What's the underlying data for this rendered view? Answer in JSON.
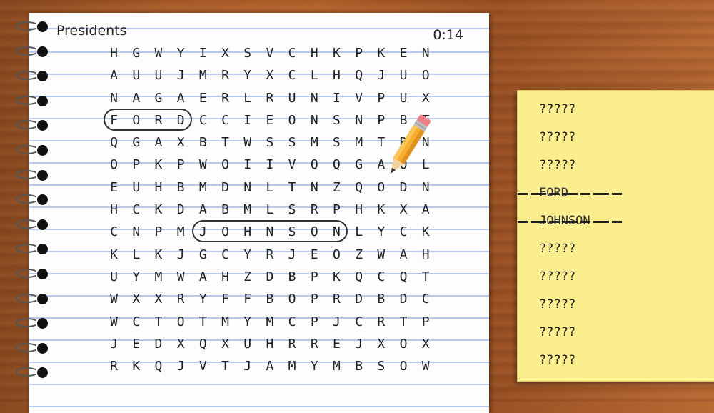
{
  "puzzle": {
    "title": "Presidents",
    "timer": "0:14",
    "grid": [
      [
        "H",
        "G",
        "W",
        "Y",
        "I",
        "X",
        "S",
        "V",
        "C",
        "H",
        "K",
        "P",
        "K",
        "E",
        "N"
      ],
      [
        "A",
        "U",
        "U",
        "J",
        "M",
        "R",
        "Y",
        "X",
        "C",
        "L",
        "H",
        "Q",
        "J",
        "U",
        "O"
      ],
      [
        "N",
        "A",
        "G",
        "A",
        "E",
        "R",
        "L",
        "R",
        "U",
        "N",
        "I",
        "V",
        "P",
        "U",
        "X"
      ],
      [
        "F",
        "O",
        "R",
        "D",
        "C",
        "C",
        "I",
        "E",
        "O",
        "N",
        "S",
        "N",
        "P",
        "B",
        "T"
      ],
      [
        "Q",
        "G",
        "A",
        "X",
        "B",
        "T",
        "W",
        "S",
        "S",
        "M",
        "S",
        "M",
        "T",
        "R",
        "N"
      ],
      [
        "O",
        "P",
        "K",
        "P",
        "W",
        "O",
        "I",
        "I",
        "V",
        "O",
        "Q",
        "G",
        "A",
        "O",
        "L"
      ],
      [
        "E",
        "U",
        "H",
        "B",
        "M",
        "D",
        "N",
        "L",
        "T",
        "N",
        "Z",
        "Q",
        "O",
        "D",
        "N"
      ],
      [
        "H",
        "C",
        "K",
        "D",
        "A",
        "B",
        "M",
        "L",
        "S",
        "R",
        "P",
        "H",
        "K",
        "X",
        "A"
      ],
      [
        "C",
        "N",
        "P",
        "M",
        "J",
        "O",
        "H",
        "N",
        "S",
        "O",
        "N",
        "L",
        "Y",
        "C",
        "K"
      ],
      [
        "K",
        "L",
        "K",
        "J",
        "G",
        "C",
        "Y",
        "R",
        "J",
        "E",
        "O",
        "Z",
        "W",
        "A",
        "H"
      ],
      [
        "U",
        "Y",
        "M",
        "W",
        "A",
        "H",
        "Z",
        "D",
        "B",
        "P",
        "K",
        "Q",
        "C",
        "Q",
        "T"
      ],
      [
        "W",
        "X",
        "X",
        "R",
        "Y",
        "F",
        "F",
        "B",
        "O",
        "P",
        "R",
        "D",
        "B",
        "D",
        "C"
      ],
      [
        "W",
        "C",
        "T",
        "O",
        "T",
        "M",
        "Y",
        "M",
        "C",
        "P",
        "J",
        "C",
        "R",
        "T",
        "P"
      ],
      [
        "J",
        "E",
        "D",
        "X",
        "Q",
        "X",
        "U",
        "H",
        "R",
        "R",
        "E",
        "J",
        "X",
        "O",
        "X"
      ],
      [
        "R",
        "K",
        "Q",
        "J",
        "V",
        "T",
        "J",
        "A",
        "M",
        "Y",
        "M",
        "B",
        "S",
        "O",
        "W"
      ]
    ]
  },
  "word_list": [
    {
      "label": "?????",
      "found": false
    },
    {
      "label": "?????",
      "found": false
    },
    {
      "label": "?????",
      "found": false
    },
    {
      "label": "FORD",
      "found": true
    },
    {
      "label": "JOHNSON",
      "found": true
    },
    {
      "label": "?????",
      "found": false
    },
    {
      "label": "?????",
      "found": false
    },
    {
      "label": "?????",
      "found": false
    },
    {
      "label": "?????",
      "found": false
    },
    {
      "label": "?????",
      "found": false
    }
  ],
  "colors": {
    "sticky_note": "#fbee8f",
    "paper_lines": "#b9c9ee",
    "desk_wood": "#a55a28"
  },
  "icons": [
    "pencil-icon",
    "spiral-binding"
  ]
}
